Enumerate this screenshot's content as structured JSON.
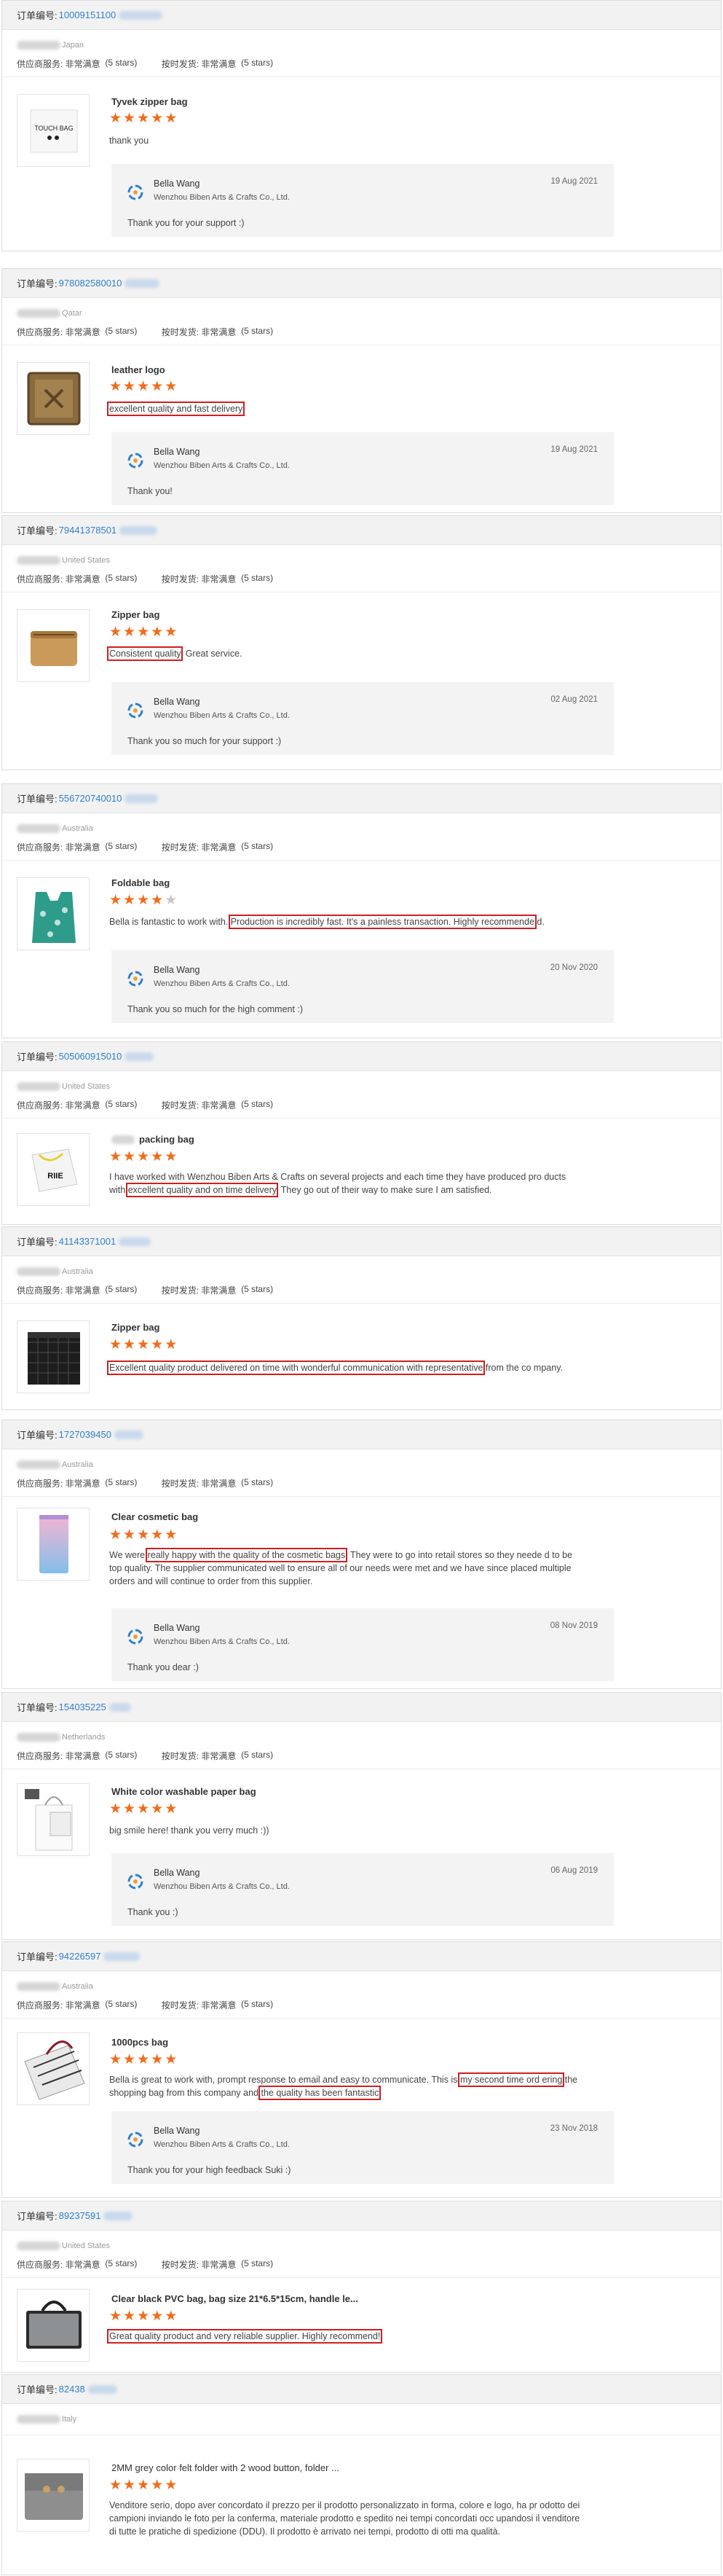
{
  "labels": {
    "order_prefix": "订单编号:",
    "supplier_service": "供应商服务: ",
    "ontime_shipping": "按时发货: ",
    "very_satisfied": "非常满意",
    "stars5": "(5 stars)"
  },
  "orders": [
    {
      "order_no": "10009151100",
      "country": "Japan",
      "product_title": "Tyvek zipper bag",
      "rating": 5,
      "review_parts": [
        {
          "t": "thank you"
        }
      ],
      "reply": {
        "name": "Bella Wang",
        "company": "Wenzhou Biben Arts & Crafts Co., Ltd.",
        "date": "19 Aug 2021",
        "text": "Thank you for your support :)"
      }
    },
    {
      "order_no": "978082580010",
      "country": "Qatar",
      "product_title": "leather logo",
      "rating": 5,
      "review_parts": [
        {
          "t": "excellent quality and fast delivery",
          "hl": true
        }
      ],
      "reply": {
        "name": "Bella Wang",
        "company": "Wenzhou Biben Arts & Crafts Co., Ltd.",
        "date": "19 Aug 2021",
        "text": "Thank you!"
      }
    },
    {
      "order_no": "79441378501",
      "country": "United States",
      "product_title": "Zipper bag",
      "rating": 5,
      "review_parts": [
        {
          "t": "Consistent quality",
          "hl": true
        },
        {
          "t": ". Great service."
        }
      ],
      "reply": {
        "name": "Bella Wang",
        "company": "Wenzhou Biben Arts & Crafts Co., Ltd.",
        "date": "02 Aug 2021",
        "text": "Thank you so much for your support :)"
      }
    },
    {
      "order_no": "556720740010",
      "country": "Australia",
      "product_title": "Foldable bag",
      "rating": 4,
      "review_parts": [
        {
          "t": "Bella is fantastic to work with. "
        },
        {
          "t": "Production is incredibly fast. It's a painless transaction. Highly recommende",
          "hl": true
        },
        {
          "t": " d."
        }
      ],
      "reply": {
        "name": "Bella Wang",
        "company": "Wenzhou Biben Arts & Crafts Co., Ltd.",
        "date": "20 Nov 2020",
        "text": "Thank you so much for the high comment :)"
      }
    },
    {
      "order_no": "505060915010",
      "country": "United States",
      "product_title": "packing bag",
      "rating": 5,
      "review_parts": [
        {
          "t": "I have worked with Wenzhou Biben Arts & Crafts on several projects and each time they have produced pro ducts with "
        },
        {
          "t": "excellent quality and on time delivery",
          "hl": true
        },
        {
          "t": ". They go out of their way to make sure I am satisfied."
        }
      ],
      "reply": null
    },
    {
      "order_no": "41143371001",
      "country": "Australia",
      "product_title": "Zipper bag",
      "rating": 5,
      "review_parts": [
        {
          "t": "Excellent quality product delivered on time with wonderful communication with representative",
          "hl": true
        },
        {
          "t": " from the co mpany."
        }
      ],
      "reply": null
    },
    {
      "order_no": "1727039450",
      "country": "Australia",
      "product_title": "Clear cosmetic bag",
      "rating": 5,
      "review_parts": [
        {
          "t": "We were "
        },
        {
          "t": "really happy with the quality of the cosmetic bags",
          "hl": true
        },
        {
          "t": ". They were to go into retail stores so they neede d to be top quality. The supplier communicated well to ensure all of our needs were met and we have since placed multiple orders and will continue to order from this supplier."
        }
      ],
      "reply": {
        "name": "Bella Wang",
        "company": "Wenzhou Biben Arts & Crafts Co., Ltd.",
        "date": "08 Nov 2019",
        "text": "Thank you dear :)"
      }
    },
    {
      "order_no": "154035225",
      "country": "Netherlands",
      "product_title": "White color washable paper bag",
      "rating": 5,
      "review_parts": [
        {
          "t": "big smile here! thank you verry much :))"
        }
      ],
      "reply": {
        "name": "Bella Wang",
        "company": "Wenzhou Biben Arts & Crafts Co., Ltd.",
        "date": "06 Aug 2019",
        "text": "Thank you :)"
      }
    },
    {
      "order_no": "94226597",
      "country": "Australia",
      "product_title": "1000pcs bag",
      "rating": 5,
      "review_parts": [
        {
          "t": "Bella is great to work with, prompt response to email and easy to communicate. This is "
        },
        {
          "t": "my second time ord ering",
          "hl": true
        },
        {
          "t": " the shopping bag from this company and "
        },
        {
          "t": "the quality has been fantastic",
          "hl": true
        },
        {
          "t": "."
        }
      ],
      "reply": {
        "name": "Bella Wang",
        "company": "Wenzhou Biben Arts & Crafts Co., Ltd.",
        "date": "23 Nov 2018",
        "text": "Thank you for your high feedback Suki :)"
      }
    },
    {
      "order_no": "89237591",
      "country": "United States",
      "product_title": "Clear black PVC bag, bag size 21*6.5*15cm, handle le...",
      "rating": 5,
      "review_parts": [
        {
          "t": "Great quality product and very reliable supplier.  Highly recommend!",
          "hl": true
        }
      ],
      "reply": null
    },
    {
      "order_no": "82438",
      "country": "Italy",
      "product_title": "2MM grey color felt folder with 2 wood button, folder ...",
      "rating": 5,
      "review_parts": [
        {
          "t": "Venditore serio, dopo aver concordato il prezzo per il prodotto personalizzato in forma, colore e logo, ha pr odotto dei campioni inviando le foto per la conferma, materiale prodotto e spedito nei tempi concordati occ upandosi il venditore di tutte le pratiche di spedizione (DDU). Il prodotto è arrivato nei tempi, prodotto di otti ma qualità."
        }
      ],
      "reply": null
    }
  ]
}
